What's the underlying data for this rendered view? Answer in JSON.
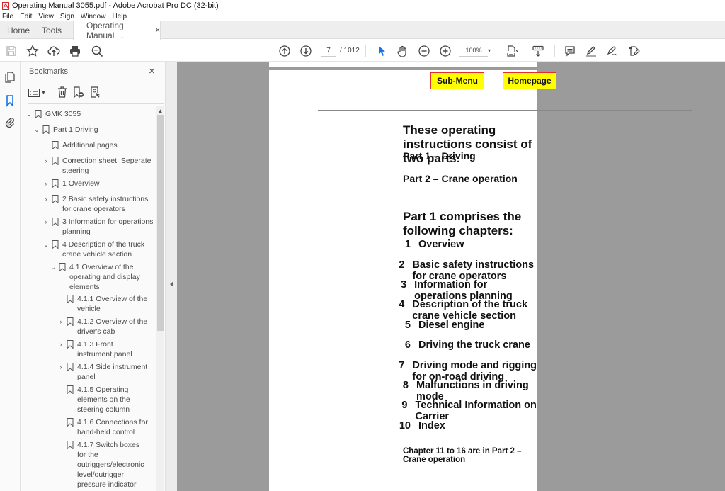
{
  "window": {
    "title": "Operating Manual 3055.pdf - Adobe Acrobat Pro DC (32-bit)",
    "app_icon": "acrobat-icon"
  },
  "menubar": [
    "File",
    "Edit",
    "View",
    "Sign",
    "Window",
    "Help"
  ],
  "tabs": [
    {
      "label": "Home",
      "active": false
    },
    {
      "label": "Tools",
      "active": false
    },
    {
      "label": "Operating Manual ...",
      "active": true,
      "close": "×"
    }
  ],
  "toolbar": {
    "left_icons": [
      "save-icon",
      "star-icon",
      "cloud-upload-icon",
      "print-icon",
      "search-zoom-icon"
    ],
    "page_current": "7",
    "page_total": "/ 1012",
    "zoom_level": "100%",
    "right_icons": [
      "comment-icon",
      "highlight-icon",
      "sign-icon",
      "fill-sign-icon"
    ],
    "accent": "#1473e6"
  },
  "left_rail": [
    "page-thumbnails-icon",
    "bookmarks-icon",
    "attachments-icon"
  ],
  "bookmarks_panel": {
    "title": "Bookmarks",
    "close": "×",
    "items": [
      {
        "label": "GMK 3055",
        "level": 0,
        "expander": "open"
      },
      {
        "label": "Part 1 Driving",
        "level": 1,
        "expander": "open"
      },
      {
        "label": "Additional pages",
        "level": 2,
        "expander": "none"
      },
      {
        "label": "Correction sheet: Seperate steering",
        "level": 2,
        "expander": "closed"
      },
      {
        "label": "1 Overview",
        "level": 2,
        "expander": "closed"
      },
      {
        "label": "2 Basic safety instructions for crane operators",
        "level": 2,
        "expander": "closed"
      },
      {
        "label": "3 Information for operations planning",
        "level": 2,
        "expander": "closed"
      },
      {
        "label": "4 Description of the truck crane vehicle section",
        "level": 2,
        "expander": "open"
      },
      {
        "label": "4.1 Overview of the operating and display elements",
        "level": 3,
        "expander": "open"
      },
      {
        "label": "4.1.1 Overview of the vehicle",
        "level": 4,
        "expander": "none"
      },
      {
        "label": "4.1.2 Overview of the driver's cab",
        "level": 4,
        "expander": "closed"
      },
      {
        "label": "4.1.3 Front instrument panel",
        "level": 4,
        "expander": "closed"
      },
      {
        "label": "4.1.4 Side instrument panel",
        "level": 4,
        "expander": "closed"
      },
      {
        "label": "4.1.5 Operating elements on the steering column",
        "level": 4,
        "expander": "none"
      },
      {
        "label": "4.1.6 Connections for hand-held control",
        "level": 4,
        "expander": "none"
      },
      {
        "label": "4.1.7 Switch boxes for the outriggers/electronic level/outrigger pressure indicator",
        "level": 4,
        "expander": "none"
      }
    ]
  },
  "document": {
    "nav_buttons": [
      {
        "label": "Sub-Menu",
        "bg": "#ffff00",
        "border": "#e52b2b"
      },
      {
        "label": "Homepage",
        "bg": "#ffff00",
        "border": "#e52b2b"
      }
    ],
    "heading1": "These operating instructions consist of two parts:",
    "parts": [
      "Part 1 – Driving",
      "Part 2 – Crane operation"
    ],
    "heading2": "Part 1 comprises the following chapters:",
    "chapters": [
      {
        "num": "1",
        "title": "Overview"
      },
      {
        "num": "2",
        "title": "Basic safety instructions for crane operators"
      },
      {
        "num": "3",
        "title": "Information for operations planning"
      },
      {
        "num": "4",
        "title": "Description of the truck crane vehicle section"
      },
      {
        "num": "5",
        "title": "Diesel engine"
      },
      {
        "num": "6",
        "title": "Driving the truck crane"
      },
      {
        "num": "7",
        "title": "Driving mode and rigging for on-road driving"
      },
      {
        "num": "8",
        "title": "Malfunctions in driving mode"
      },
      {
        "num": "9",
        "title": "Technical Information on Carrier"
      },
      {
        "num": "10",
        "title": "Index"
      }
    ],
    "note": "Chapter 11 to 16 are in Part 2 – Crane operation"
  }
}
